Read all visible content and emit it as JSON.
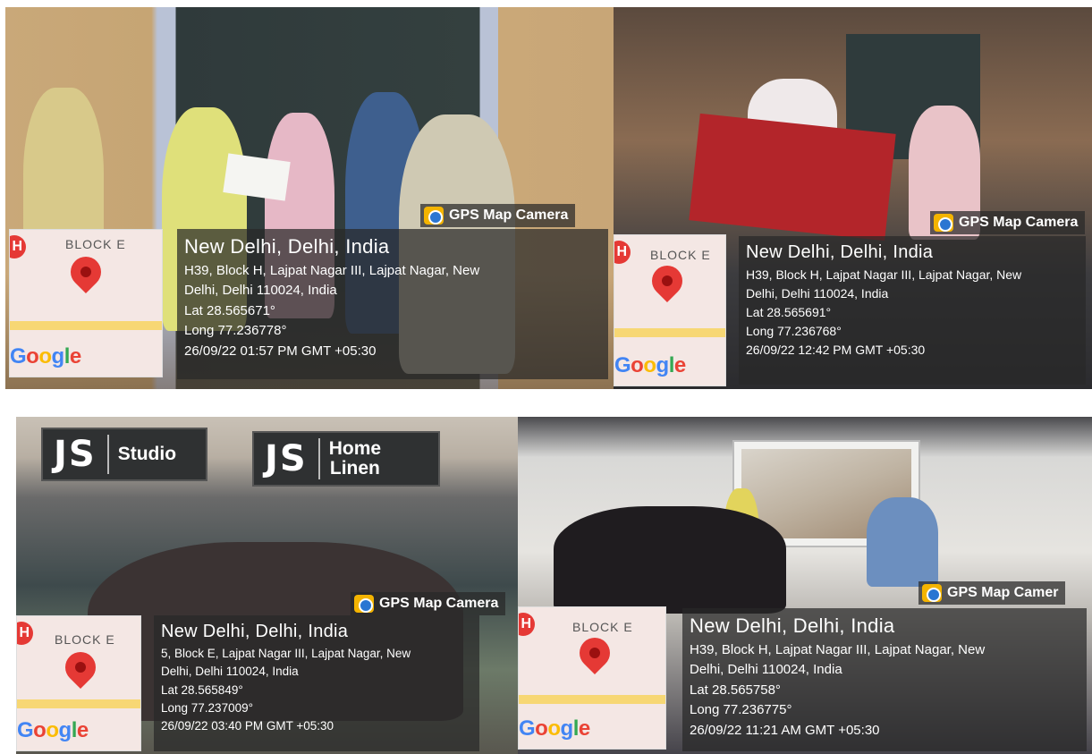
{
  "photos": [
    {
      "camera_label": "GPS Map Camera",
      "location": "New Delhi, Delhi, India",
      "address_line1": "H39, Block H, Lajpat Nagar III, Lajpat Nagar, New",
      "address_line2": "Delhi, Delhi 110024, India",
      "lat": "Lat 28.565671°",
      "long": "Long 77.236778°",
      "timestamp": "26/09/22 01:57 PM GMT +05:30",
      "map_label": "BLOCK E",
      "map_brand": [
        "G",
        "o",
        "o",
        "g",
        "l",
        "e"
      ]
    },
    {
      "camera_label": "GPS Map Camera",
      "location": "New Delhi, Delhi, India",
      "address_line1": "H39, Block H, Lajpat Nagar III, Lajpat Nagar, New",
      "address_line2": "Delhi, Delhi 110024, India",
      "lat": "Lat 28.565691°",
      "long": "Long 77.236768°",
      "timestamp": "26/09/22 12:42 PM GMT +05:30",
      "map_label": "BLOCK E",
      "map_brand": [
        "G",
        "o",
        "o",
        "g",
        "l",
        "e"
      ]
    },
    {
      "camera_label": "GPS Map Camera",
      "location": "New Delhi, Delhi, India",
      "address_line1": "5, Block E, Lajpat Nagar III, Lajpat Nagar, New",
      "address_line2": "Delhi, Delhi 110024, India",
      "lat": "Lat 28.565849°",
      "long": "Long 77.237009°",
      "timestamp": "26/09/22 03:40 PM GMT +05:30",
      "map_label": "BLOCK E",
      "map_brand": [
        "G",
        "o",
        "o",
        "g",
        "l",
        "e"
      ],
      "signs": {
        "studio": {
          "logo": "JS",
          "text": "Studio"
        },
        "home_linen": {
          "logo": "JS",
          "text_line1": "Home",
          "text_line2": "Linen"
        }
      }
    },
    {
      "camera_label": "GPS Map Camer",
      "location": "New Delhi, Delhi, India",
      "address_line1": "H39, Block H, Lajpat Nagar III, Lajpat Nagar, New",
      "address_line2": "Delhi, Delhi 110024, India",
      "lat": "Lat 28.565758°",
      "long": "Long 77.236775°",
      "timestamp": "26/09/22 11:21 AM GMT +05:30",
      "map_label": "BLOCK E",
      "map_brand": [
        "G",
        "o",
        "o",
        "g",
        "l",
        "e"
      ]
    }
  ],
  "icons": {
    "camera": "gps-map-camera-icon",
    "pin": "map-pin-icon",
    "hospital": "hospital-pin-icon"
  },
  "colors": {
    "overlay": "#282828",
    "pin": "#e53935",
    "camera_icon": "#f4b400",
    "google_blue": "#4285f4",
    "google_red": "#ea4335",
    "google_yellow": "#fbbc05",
    "google_green": "#34a853"
  }
}
